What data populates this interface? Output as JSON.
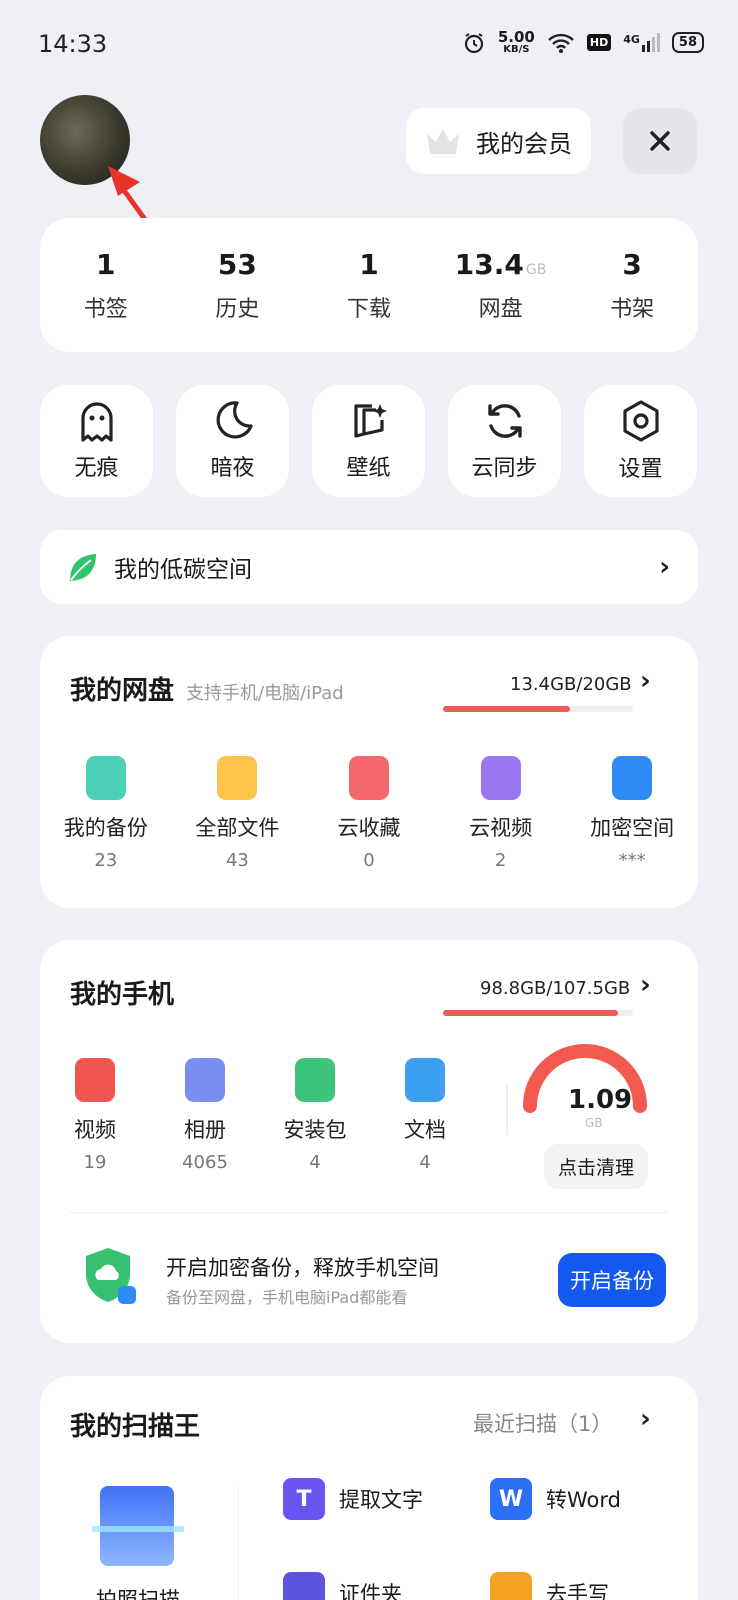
{
  "status_bar": {
    "time": "14:33",
    "net_speed": "5.00",
    "net_unit": "KB/S",
    "hd": "HD",
    "signal": "4G",
    "battery": "58"
  },
  "header": {
    "vip_label": "我的会员"
  },
  "stats": [
    {
      "value": "1",
      "unit": "",
      "label": "书签"
    },
    {
      "value": "53",
      "unit": "",
      "label": "历史"
    },
    {
      "value": "1",
      "unit": "",
      "label": "下载"
    },
    {
      "value": "13.4",
      "unit": "GB",
      "label": "网盘"
    },
    {
      "value": "3",
      "unit": "",
      "label": "书架"
    }
  ],
  "tools": [
    {
      "label": "无痕",
      "icon": "ghost-icon"
    },
    {
      "label": "暗夜",
      "icon": "moon-icon"
    },
    {
      "label": "壁纸",
      "icon": "wallpaper-icon"
    },
    {
      "label": "云同步",
      "icon": "sync-icon"
    },
    {
      "label": "设置",
      "icon": "settings-icon"
    }
  ],
  "low_carbon": {
    "label": "我的低碳空间"
  },
  "netdisk": {
    "title": "我的网盘",
    "subtitle": "支持手机/电脑/iPad",
    "usage": "13.4GB/20GB",
    "usage_fraction": 0.67,
    "items": [
      {
        "label": "我的备份",
        "count": "23",
        "color": "#4cd1b6"
      },
      {
        "label": "全部文件",
        "count": "43",
        "color": "#ffc24b"
      },
      {
        "label": "云收藏",
        "count": "0",
        "color": "#f4686b"
      },
      {
        "label": "云视频",
        "count": "2",
        "color": "#9a76f0"
      },
      {
        "label": "加密空间",
        "count": "***",
        "color": "#2f8cf5"
      }
    ]
  },
  "phone": {
    "title": "我的手机",
    "usage": "98.8GB/107.5GB",
    "usage_fraction": 0.92,
    "items": [
      {
        "label": "视频",
        "count": "19",
        "color": "#f0564f"
      },
      {
        "label": "相册",
        "count": "4065",
        "color": "#7a8df0"
      },
      {
        "label": "安装包",
        "count": "4",
        "color": "#3ec37a"
      },
      {
        "label": "文档",
        "count": "4",
        "color": "#3da0f2"
      }
    ],
    "gauge_value": "1.09",
    "gauge_unit": "GB",
    "clean_label": "点击清理",
    "backup_title": "开启加密备份，释放手机空间",
    "backup_sub": "备份至网盘，手机电脑iPad都能看",
    "backup_btn": "开启备份"
  },
  "scanner": {
    "title": "我的扫描王",
    "recent": "最近扫描（1）",
    "main_label": "拍照扫描",
    "items": [
      {
        "label": "提取文字",
        "glyph": "T",
        "color": "#6a54f0"
      },
      {
        "label": "转Word",
        "glyph": "W",
        "color": "#2b6ff2"
      },
      {
        "label": "证件夹",
        "glyph": "",
        "color": "#5a54e0"
      },
      {
        "label": "去手写",
        "glyph": "",
        "color": "#f5a323"
      }
    ]
  }
}
